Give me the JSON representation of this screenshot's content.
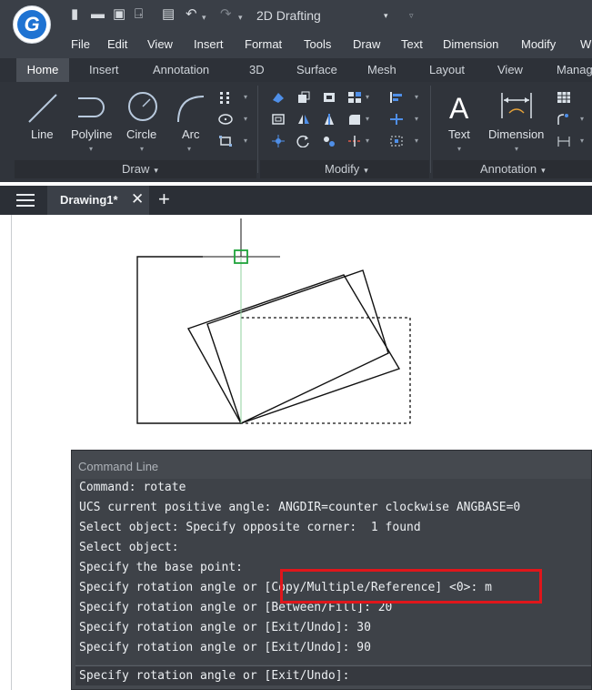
{
  "app": {
    "logo_letter": "G",
    "workspace": "2D Drafting",
    "brand_color": "#1f73d2"
  },
  "quick_access": {
    "icons": [
      "new-file-icon",
      "open-folder-icon",
      "save-icon",
      "save-as-icon",
      "print-icon",
      "undo-icon",
      "redo-icon",
      "workspace-dropdown-icon"
    ]
  },
  "menu": [
    "File",
    "Edit",
    "View",
    "Insert",
    "Format",
    "Tools",
    "Draw",
    "Text",
    "Dimension",
    "Modify",
    "W"
  ],
  "ribbon_tabs": [
    "Home",
    "Insert",
    "Annotation",
    "3D",
    "Surface",
    "Mesh",
    "Layout",
    "View",
    "Manag"
  ],
  "ribbon": {
    "draw": {
      "label": "Draw",
      "tools": [
        "Line",
        "Polyline",
        "Circle",
        "Arc"
      ]
    },
    "modify": {
      "label": "Modify"
    },
    "annotation": {
      "label": "Annotation",
      "tools": [
        "Text",
        "Dimension"
      ]
    }
  },
  "document": {
    "tab_label": "Drawing1*",
    "close_glyph": "✕",
    "new_tab_glyph": "+"
  },
  "command_line": {
    "title": "Command Line",
    "history": [
      "Command: rotate",
      "UCS current positive angle: ANGDIR=counter clockwise ANGBASE=0",
      "Select object: Specify opposite corner:  1 found",
      "Select object:",
      "Specify the base point:",
      "Specify rotation angle or [Copy/Multiple/Reference] <0>: m",
      "Specify rotation angle or [Between/Fill]: 20",
      "Specify rotation angle or [Exit/Undo]: 30",
      "Specify rotation angle or [Exit/Undo]: 90"
    ],
    "prompt": "Specify rotation angle or [Exit/Undo]:",
    "highlight_color": "#e0161b"
  }
}
